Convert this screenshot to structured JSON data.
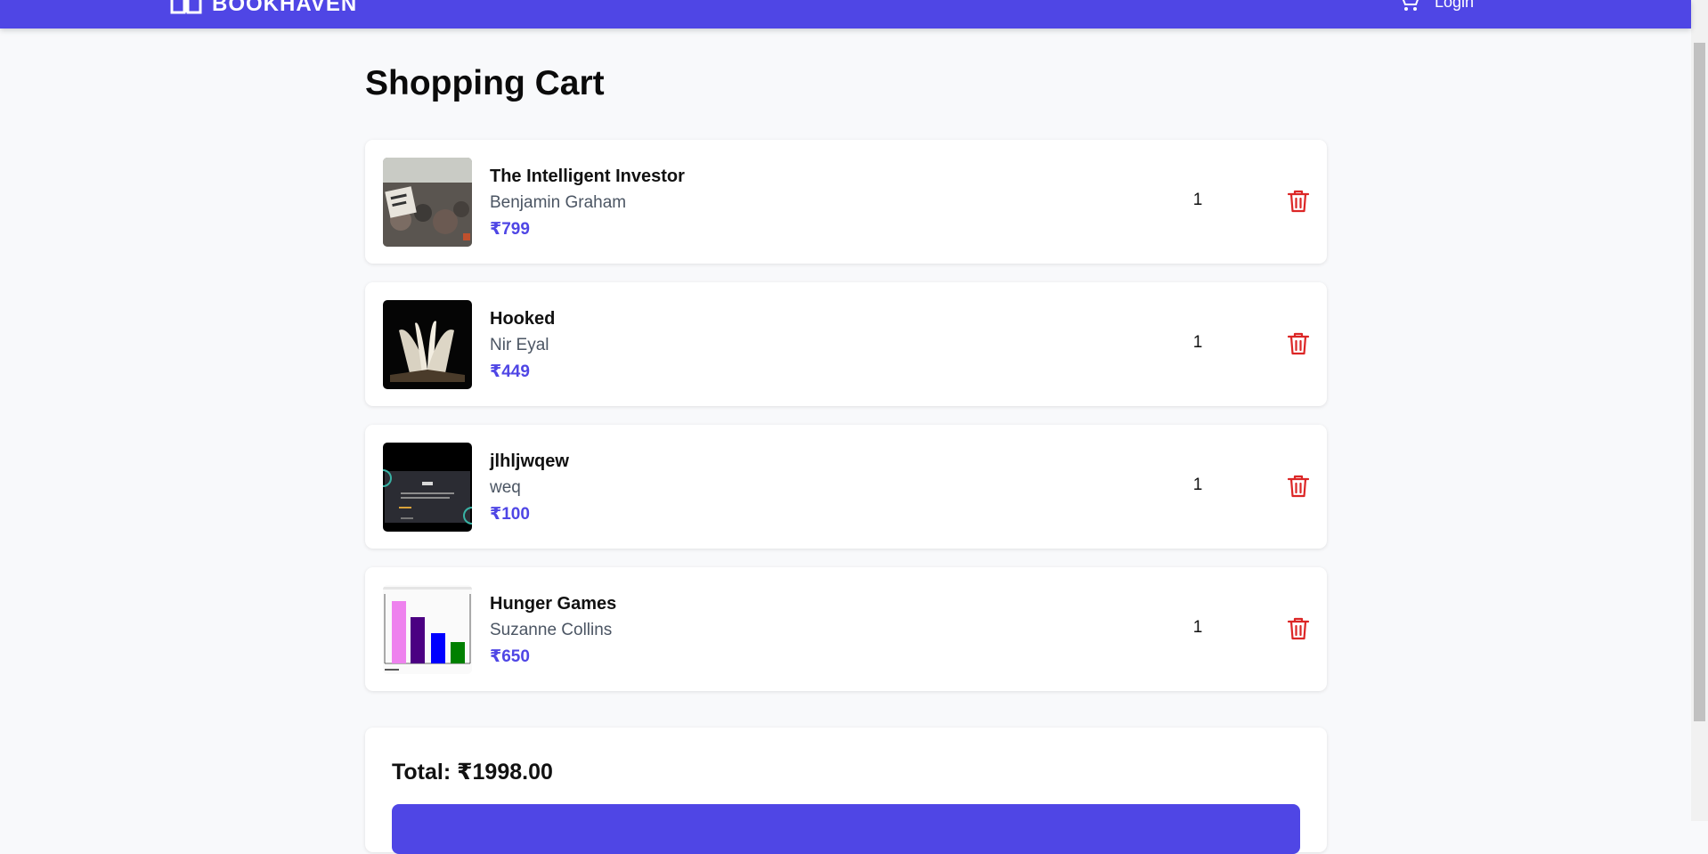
{
  "navbar": {
    "brand_name": "BOOKHAVEN",
    "brand_icon": "book-icon",
    "cart_icon": "cart-icon",
    "nav_link": "Login",
    "color": "#4f46e5"
  },
  "page": {
    "title": "Shopping Cart"
  },
  "cart": {
    "items": [
      {
        "title": "The Intelligent Investor",
        "author": "Benjamin Graham",
        "price": "₹799",
        "quantity": "1"
      },
      {
        "title": "Hooked",
        "author": "Nir Eyal",
        "price": "₹449",
        "quantity": "1"
      },
      {
        "title": "jlhljwqew",
        "author": "weq",
        "price": "₹100",
        "quantity": "1"
      },
      {
        "title": "Hunger Games",
        "author": "Suzanne Collins",
        "price": "₹650",
        "quantity": "1"
      }
    ],
    "delete_icon": "trash-icon",
    "delete_color": "#dc2626",
    "price_color": "#4f46e5"
  },
  "summary": {
    "total_label": "Total: ₹1998.00"
  }
}
